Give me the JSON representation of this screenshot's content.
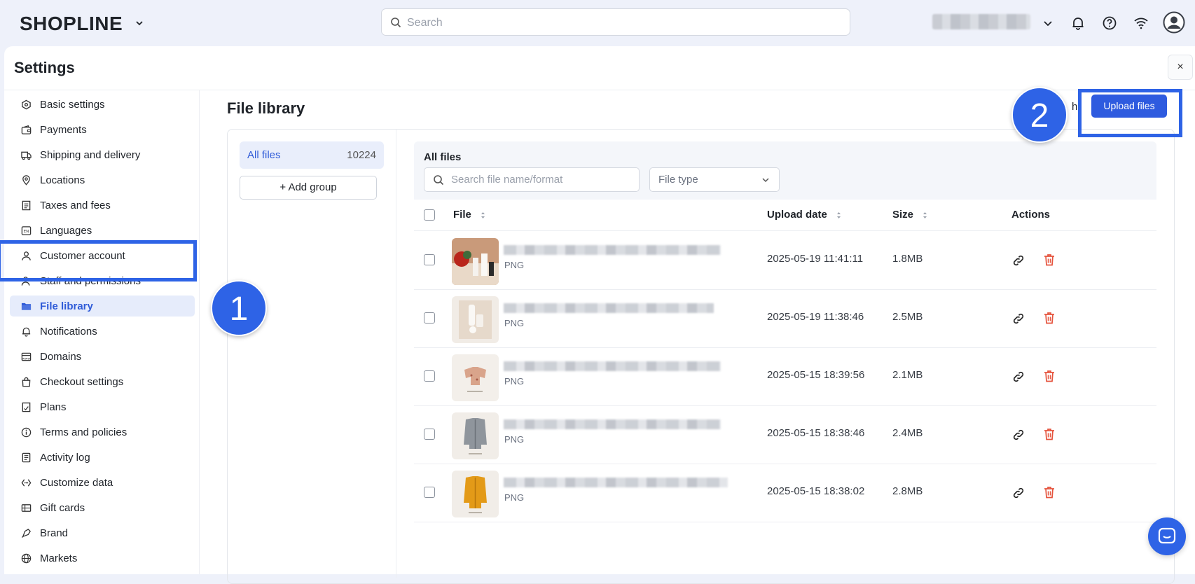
{
  "topbar": {
    "logo": "SHOPLINE",
    "search_placeholder": "Search"
  },
  "settings": {
    "title": "Settings",
    "close_label": "×"
  },
  "sidebar": {
    "items": [
      {
        "label": "Basic settings",
        "icon": "hexagon-icon"
      },
      {
        "label": "Payments",
        "icon": "wallet-icon"
      },
      {
        "label": "Shipping and delivery",
        "icon": "truck-icon"
      },
      {
        "label": "Locations",
        "icon": "location-pin-icon"
      },
      {
        "label": "Taxes and fees",
        "icon": "receipt-icon"
      },
      {
        "label": "Languages",
        "icon": "language-icon"
      },
      {
        "label": "Customer account",
        "icon": "user-icon"
      },
      {
        "label": "Staff and permissions",
        "icon": "staff-icon"
      },
      {
        "label": "File library",
        "icon": "folder-icon",
        "active": true
      },
      {
        "label": "Notifications",
        "icon": "bell-icon"
      },
      {
        "label": "Domains",
        "icon": "domain-icon"
      },
      {
        "label": "Checkout settings",
        "icon": "bag-icon"
      },
      {
        "label": "Plans",
        "icon": "plan-icon"
      },
      {
        "label": "Terms and policies",
        "icon": "info-icon"
      },
      {
        "label": "Activity log",
        "icon": "log-icon"
      },
      {
        "label": "Customize data",
        "icon": "code-icon"
      },
      {
        "label": "Gift cards",
        "icon": "gift-card-icon"
      },
      {
        "label": "Brand",
        "icon": "brand-icon"
      },
      {
        "label": "Markets",
        "icon": "globe-icon"
      }
    ]
  },
  "annotations": {
    "step1": "1",
    "step2": "2"
  },
  "content": {
    "title": "File library",
    "partial_button": "h",
    "upload_label": "Upload files"
  },
  "groups": {
    "all_label": "All files",
    "all_count": "10224",
    "add_group_label": "Add group"
  },
  "files": {
    "header_title": "All files",
    "search_placeholder": "Search file name/format",
    "type_placeholder": "File type",
    "columns": {
      "file": "File",
      "upload_date": "Upload date",
      "size": "Size",
      "actions": "Actions"
    },
    "rows": [
      {
        "type": "PNG",
        "date": "2025-05-19 11:41:11",
        "size": "1.8MB"
      },
      {
        "type": "PNG",
        "date": "2025-05-19 11:38:46",
        "size": "2.5MB"
      },
      {
        "type": "PNG",
        "date": "2025-05-15 18:39:56",
        "size": "2.1MB"
      },
      {
        "type": "PNG",
        "date": "2025-05-15 18:38:46",
        "size": "2.4MB"
      },
      {
        "type": "PNG",
        "date": "2025-05-15 18:38:02",
        "size": "2.8MB"
      }
    ]
  },
  "colors": {
    "accent": "#2e5bdf",
    "highlight": "#2e63e6",
    "delete": "#e5533d"
  }
}
